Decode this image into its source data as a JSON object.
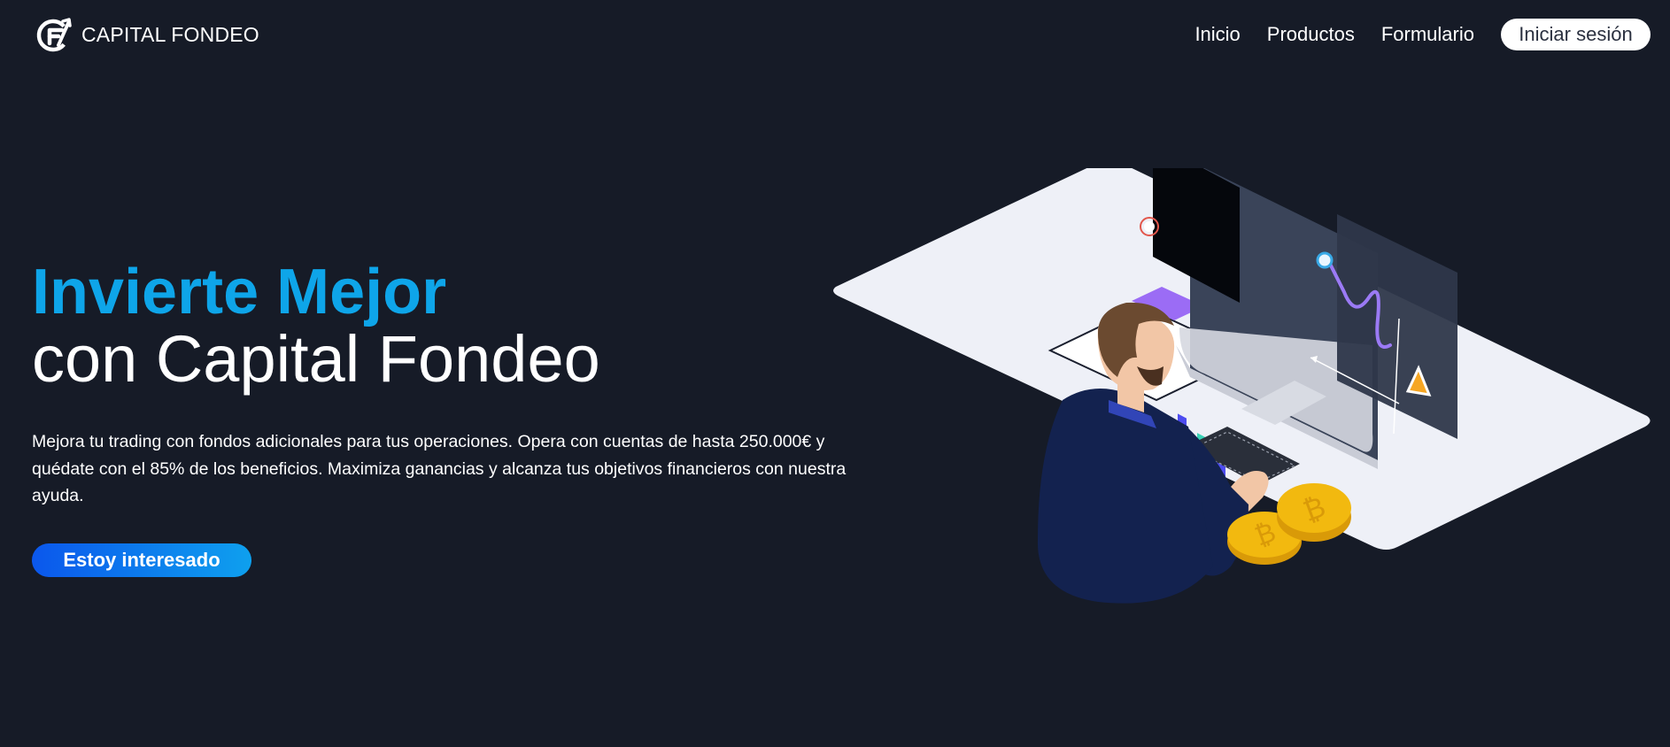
{
  "brand": {
    "name": "CAPITAL FONDEO",
    "logo_icon": "cf-logo-icon"
  },
  "nav": {
    "items": [
      "Inicio",
      "Productos",
      "Formulario"
    ],
    "login_label": "Iniciar sesión"
  },
  "hero": {
    "title_accent": "Invierte Mejor",
    "title_main": "con Capital Fondeo",
    "description": "Mejora tu trading con fondos adicionales para tus operaciones. Opera con cuentas de hasta 250.000€ y quédate con el 85% de los beneficios. Maximiza ganancias y alcanza tus objetivos financieros con nuestra ayuda.",
    "cta_label": "Estoy interesado"
  },
  "colors": {
    "background": "#161b27",
    "accent": "#0ea5e9",
    "cta_start": "#0b57ec",
    "cta_end": "#0ea0ee",
    "desk": "#eef0f7",
    "jacket": "#13224f",
    "coin": "#f2b90f"
  }
}
